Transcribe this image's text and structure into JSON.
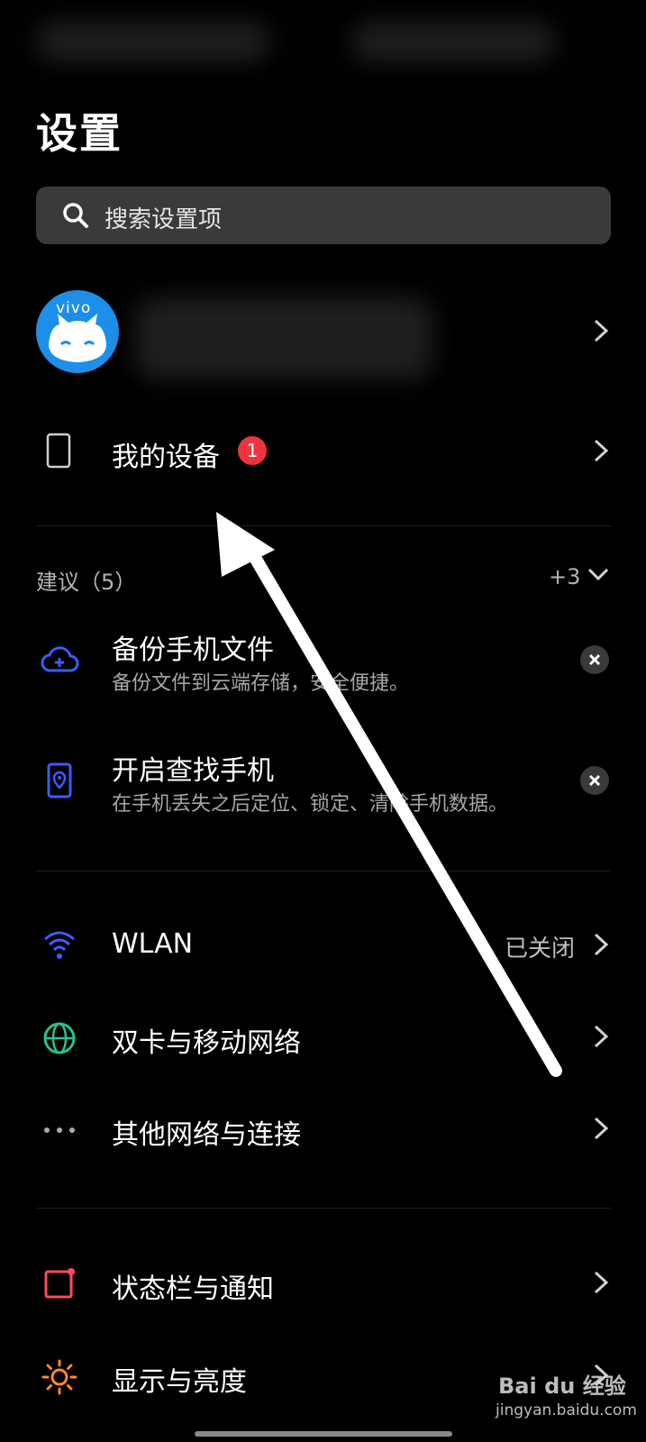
{
  "page": {
    "title": "设置"
  },
  "search": {
    "placeholder": "搜索设置项"
  },
  "account": {
    "avatar_brand": "vivo"
  },
  "my_device": {
    "label": "我的设备",
    "badge": "1"
  },
  "suggestions": {
    "title": "建议（5）",
    "more": "+3",
    "items": [
      {
        "title": "备份手机文件",
        "desc": "备份文件到云端存储，安全便捷。",
        "icon": "cloud-upload-icon"
      },
      {
        "title": "开启查找手机",
        "desc": "在手机丢失之后定位、锁定、清除手机数据。",
        "icon": "phone-locate-icon"
      }
    ]
  },
  "network": [
    {
      "label": "WLAN",
      "value": "已关闭",
      "icon": "wifi-icon"
    },
    {
      "label": "双卡与移动网络",
      "icon": "globe-icon"
    },
    {
      "label": "其他网络与连接",
      "icon": "more-dots-icon"
    }
  ],
  "system": [
    {
      "label": "状态栏与通知",
      "icon": "notification-icon"
    },
    {
      "label": "显示与亮度",
      "icon": "brightness-icon"
    }
  ],
  "watermark": {
    "brand": "Bai du 经验",
    "url": "jingyan.baidu.com"
  },
  "colors": {
    "accent_blue": "#3a5cff",
    "badge_red": "#f0343f",
    "wifi": "#3a5cff",
    "globe": "#29c28c",
    "notify": "#ff4a5c",
    "sun": "#ff8a2a"
  }
}
